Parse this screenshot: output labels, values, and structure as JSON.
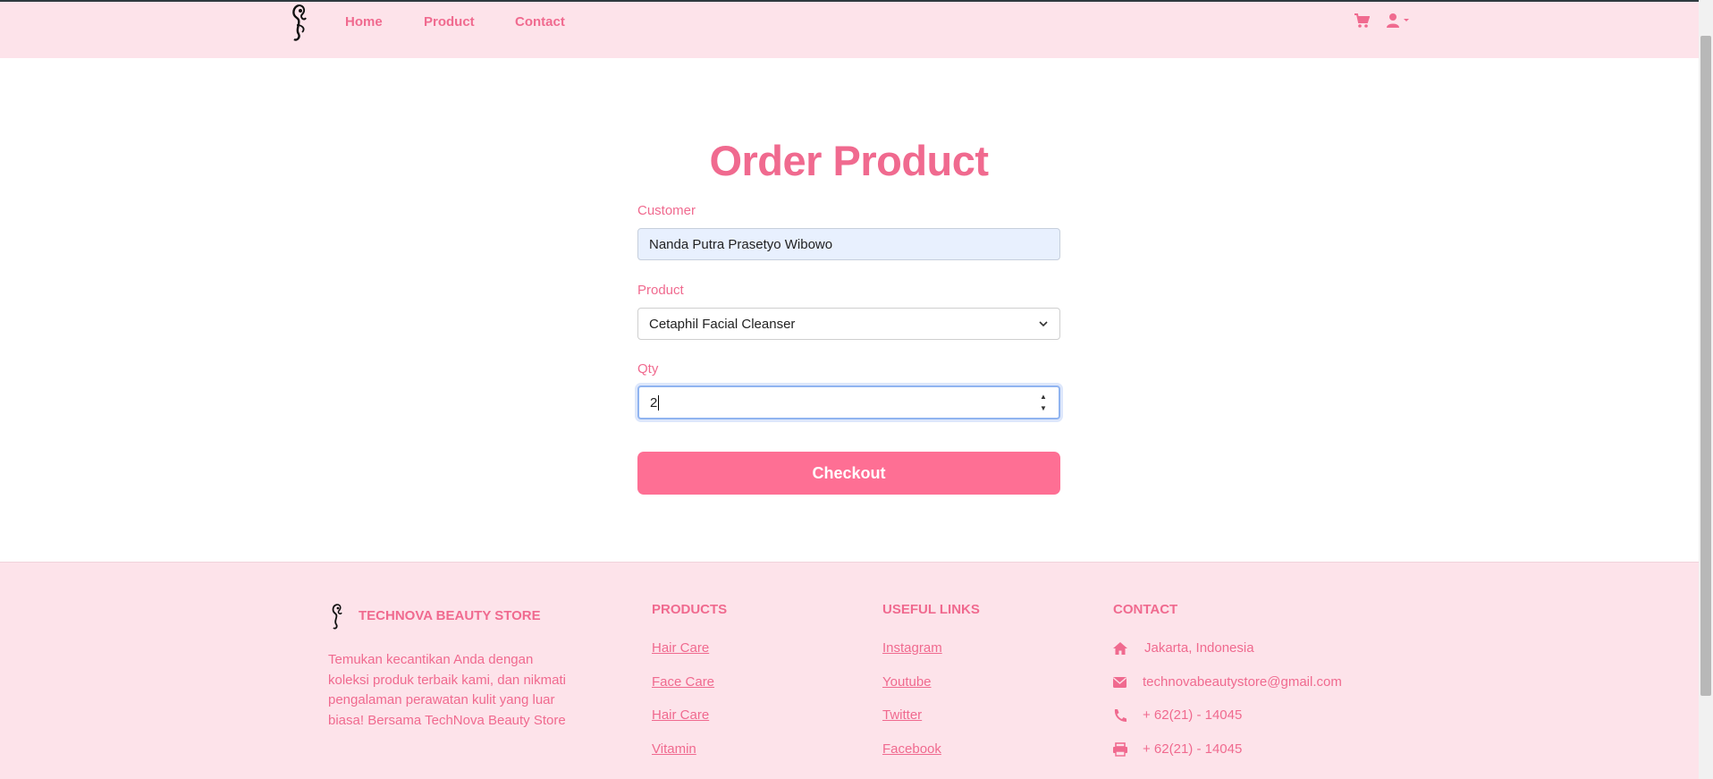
{
  "navbar": {
    "links": [
      "Home",
      "Product",
      "Contact"
    ]
  },
  "page": {
    "title": "Order Product"
  },
  "form": {
    "customer_label": "Customer",
    "customer_value": "Nanda Putra Prasetyo Wibowo",
    "product_label": "Product",
    "product_value": "Cetaphil Facial Cleanser",
    "qty_label": "Qty",
    "qty_value": "2",
    "checkout_label": "Checkout"
  },
  "footer": {
    "brand": "TECHNOVA BEAUTY STORE",
    "description": "Temukan kecantikan Anda dengan koleksi produk terbaik kami, dan nikmati pengalaman perawatan kulit yang luar biasa! Bersama TechNova Beauty Store",
    "products_heading": "PRODUCTS",
    "products": [
      "Hair Care",
      "Face Care",
      "Hair Care",
      "Vitamin"
    ],
    "links_heading": "USEFUL LINKS",
    "links": [
      "Instagram",
      "Youtube",
      "Twitter",
      "Facebook"
    ],
    "contact_heading": "CONTACT",
    "contact": {
      "address": "Jakarta, Indonesia",
      "email": "technovabeautystore@gmail.com",
      "phone": "+ 62(21) - 14045",
      "fax": "+ 62(21) - 14045"
    }
  },
  "icons": {
    "logo": "logo-icon",
    "cart": "cart-icon",
    "user": "user-icon",
    "home": "home-icon",
    "envelope": "envelope-icon",
    "phone": "phone-icon",
    "print": "print-icon"
  },
  "colors": {
    "accent": "#f06a8f",
    "button": "#fe6f94",
    "navbar_bg": "#fde3ea",
    "autofill_bg": "#e8f0fe"
  }
}
